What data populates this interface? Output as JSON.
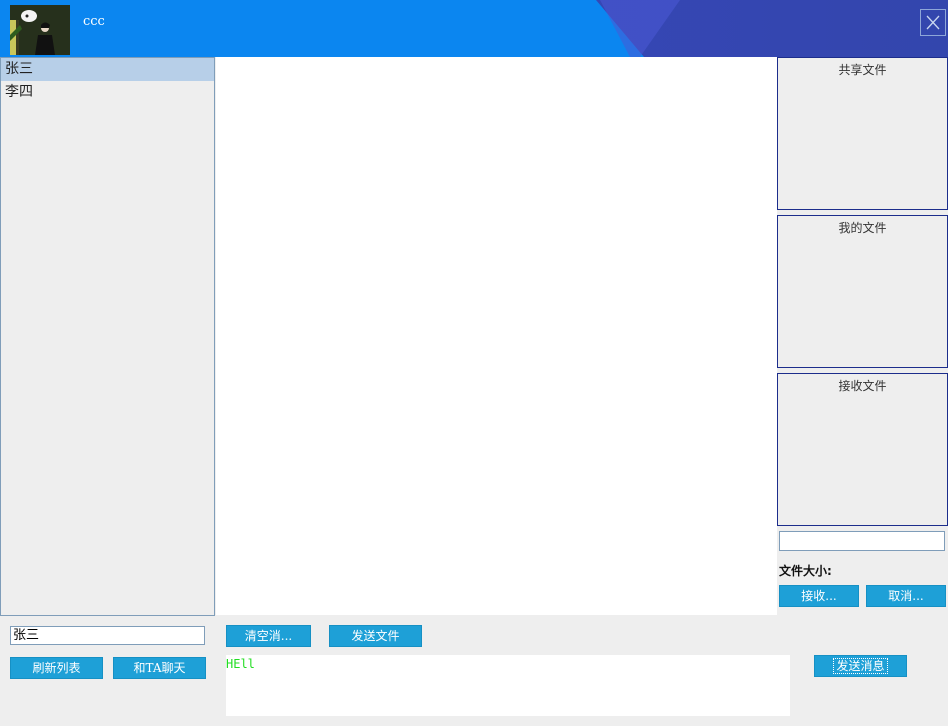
{
  "header": {
    "user_name": "ccc"
  },
  "contacts": [
    {
      "name": "张三",
      "selected": true
    },
    {
      "name": "李四",
      "selected": false
    }
  ],
  "file_panels": {
    "shared": "共享文件",
    "mine": "我的文件",
    "receive": "接收文件"
  },
  "file_size_label": "文件大小:",
  "buttons": {
    "receive": "接收...",
    "cancel": "取消...",
    "clear": "清空消...",
    "send_file": "发送文件",
    "refresh": "刷新列表",
    "chat_with": "和TA聊天",
    "send_message": "发送消息"
  },
  "target_user": "张三",
  "message_input": "HEll",
  "colors": {
    "header": "#0b86f0",
    "header_dark": "#3346ad",
    "button": "#1ea0d7",
    "message_text": "#22dd22"
  }
}
